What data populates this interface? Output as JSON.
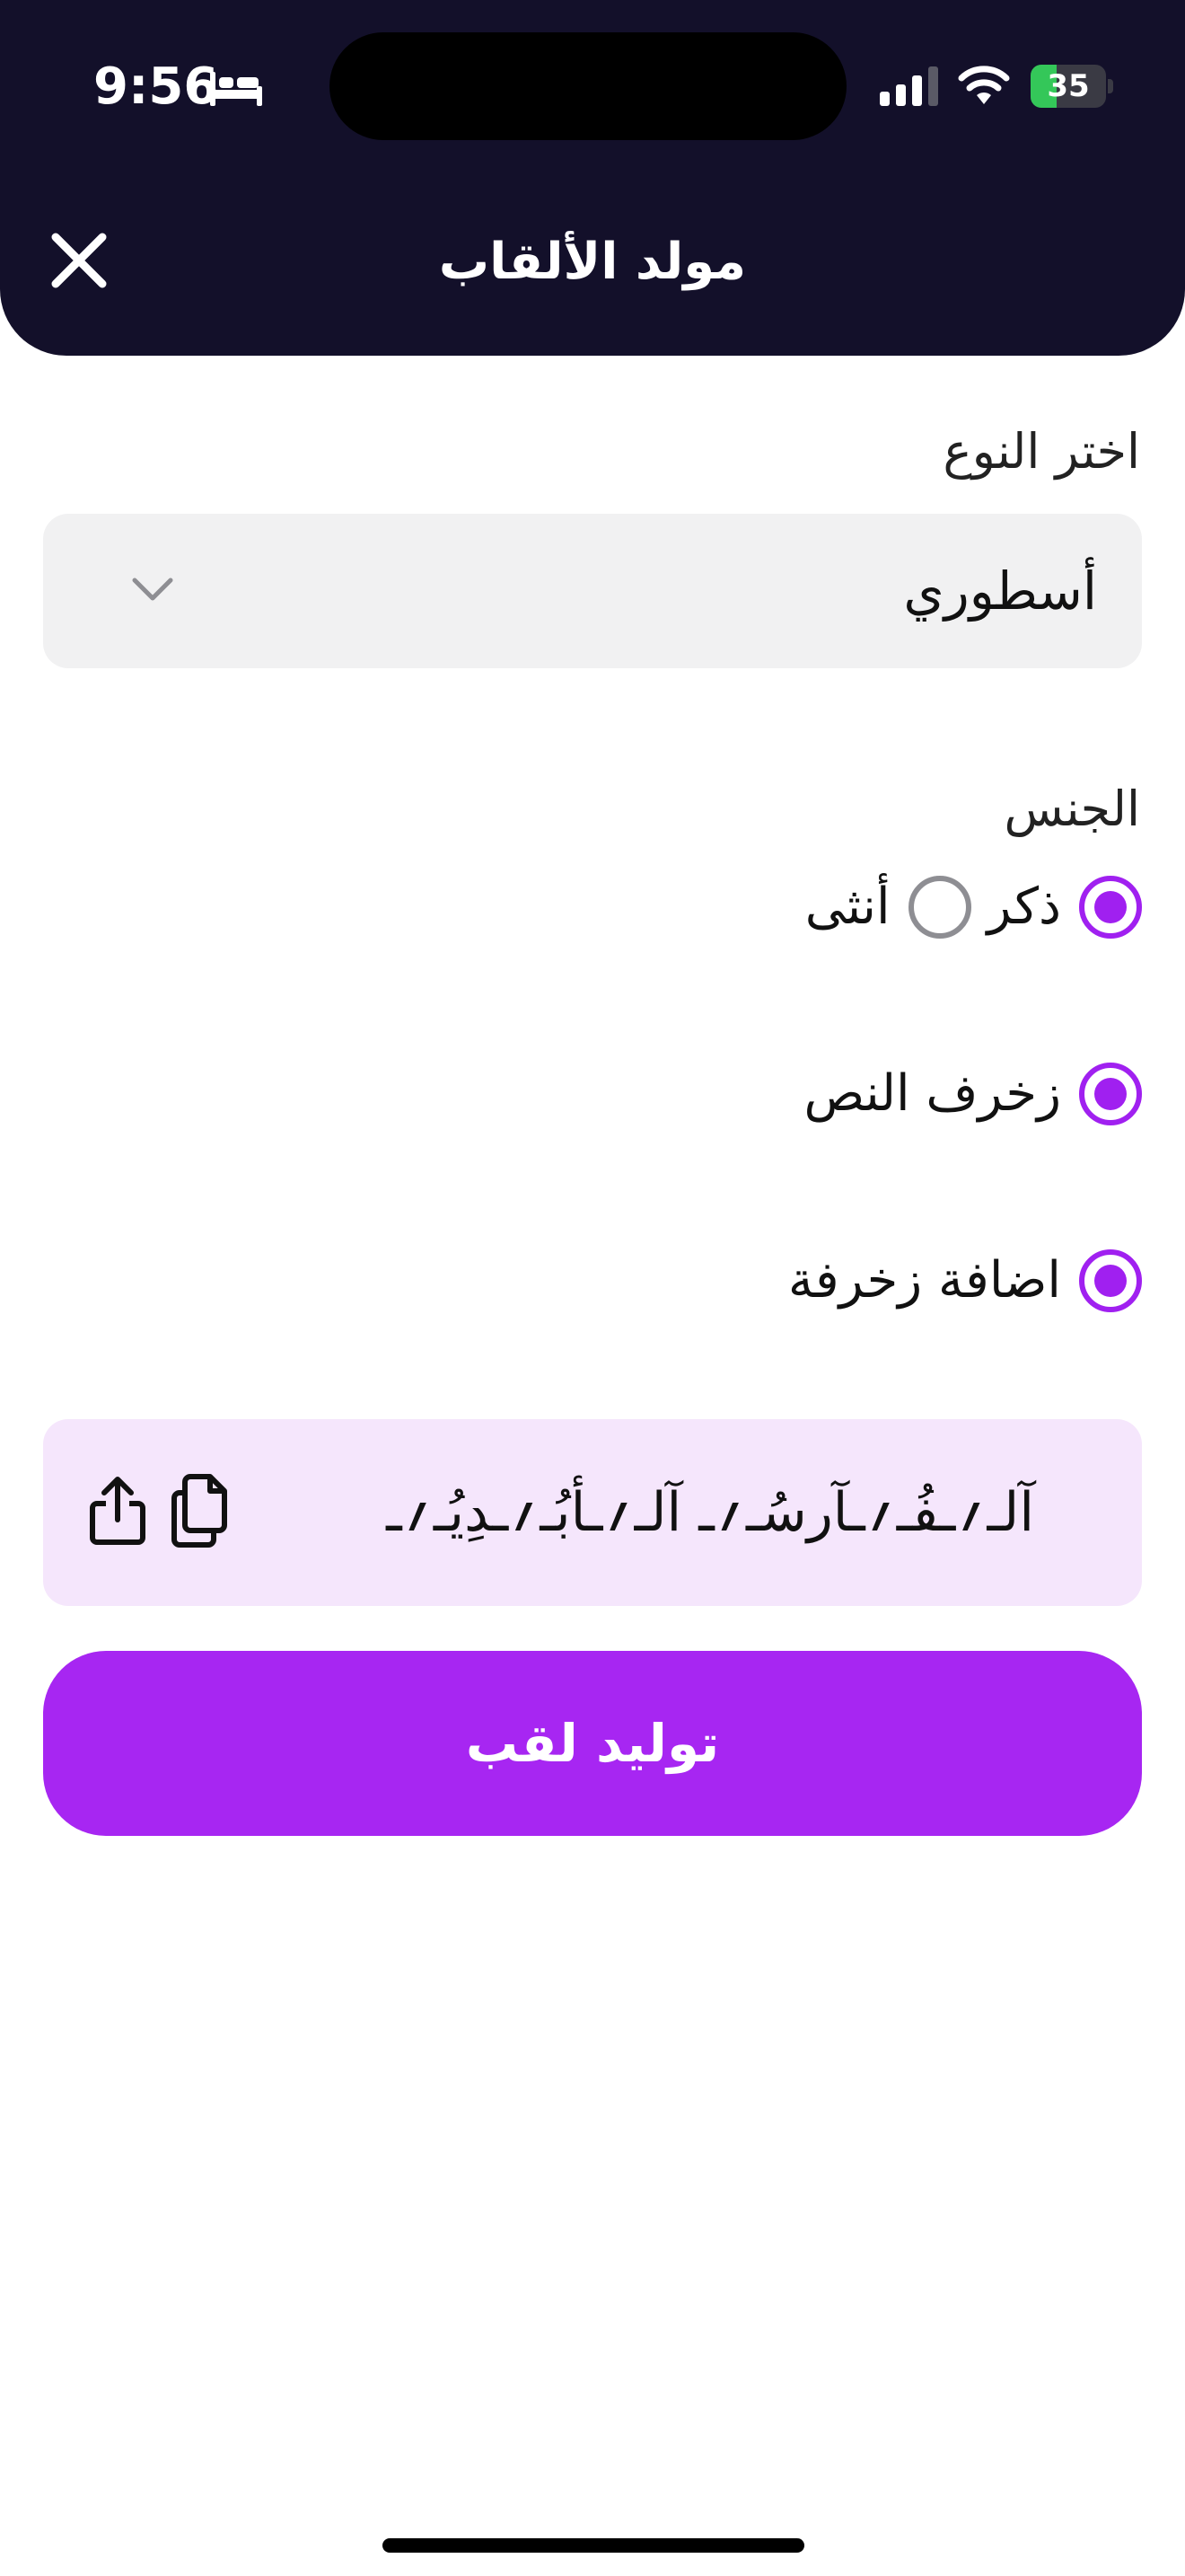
{
  "status_bar": {
    "time": "9:56",
    "battery_level": "35",
    "battery_fraction": 0.35,
    "icons": [
      "bed-icon",
      "cellular-signal-icon",
      "wifi-icon",
      "battery-icon"
    ]
  },
  "header": {
    "title": "مولد الألقاب",
    "close_icon": "close-icon"
  },
  "type_select": {
    "label": "اختر النوع",
    "value": "أسطوري",
    "icon": "chevron-down-icon"
  },
  "gender": {
    "label": "الجنس",
    "options": [
      {
        "label": "ذكر",
        "selected": true
      },
      {
        "label": "أنثى",
        "selected": false
      }
    ]
  },
  "options": {
    "decorate_text": {
      "label": "زخرف النص",
      "selected": true
    },
    "add_decoration": {
      "label": "اضافة زخرفة",
      "selected": true
    }
  },
  "result": {
    "text": "آلـ؍ـفُـ؍ـآرسُـ؍ـ آلـ؍ـأبُـ؍ـدِيُـ؍ـ",
    "icons": [
      "copy-icon",
      "share-icon"
    ]
  },
  "generate_button": {
    "label": "توليد لقب"
  },
  "colors": {
    "header_bg": "#13102a",
    "accent": "#a726f2",
    "result_bg": "#f5e6fc",
    "select_bg": "#f1f1f2"
  }
}
